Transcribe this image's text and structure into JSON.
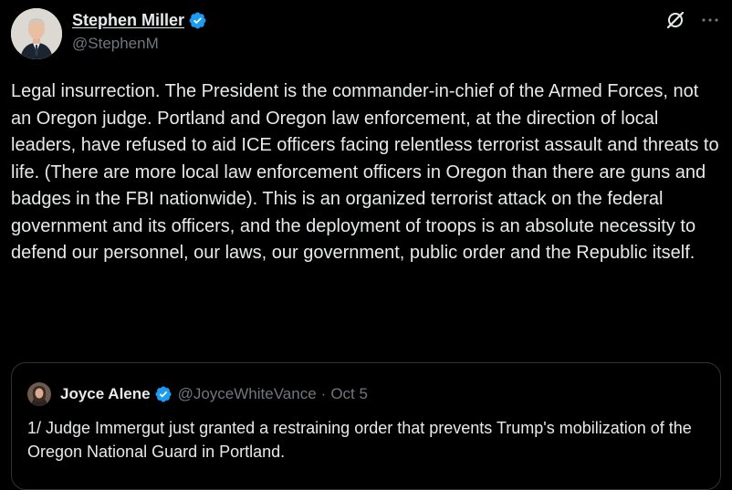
{
  "author": {
    "name": "Stephen Miller",
    "handle": "@StephenM",
    "verified": true,
    "avatar_icon": "avatar-man-suit"
  },
  "actions": {
    "grok_icon": "grok-icon",
    "more_icon": "more-icon"
  },
  "tweet": {
    "text": "Legal insurrection. The President is the commander-in-chief of the Armed Forces, not an Oregon judge. Portland and Oregon law enforcement, at the direction of local leaders, have refused to aid ICE officers facing relentless terrorist assault and threats to life. (There are more local law enforcement officers in Oregon than there are guns and badges in the FBI nationwide). This is an organized terrorist attack on the federal government and its officers, and the deployment of troops is an absolute necessity to defend our personnel, our laws, our government, public order and the Republic itself."
  },
  "quote": {
    "name": "Joyce Alene",
    "handle": "@JoyceWhiteVance",
    "separator": "·",
    "date": "Oct 5",
    "verified": true,
    "text": "1/ Judge Immergut just granted a restraining order that prevents Trump's mobilization of the Oregon National Guard in Portland."
  },
  "colors": {
    "background": "#000000",
    "text": "#e7e9ea",
    "muted": "#71767b",
    "verified": "#1d9bf0",
    "border": "#2f3336"
  }
}
